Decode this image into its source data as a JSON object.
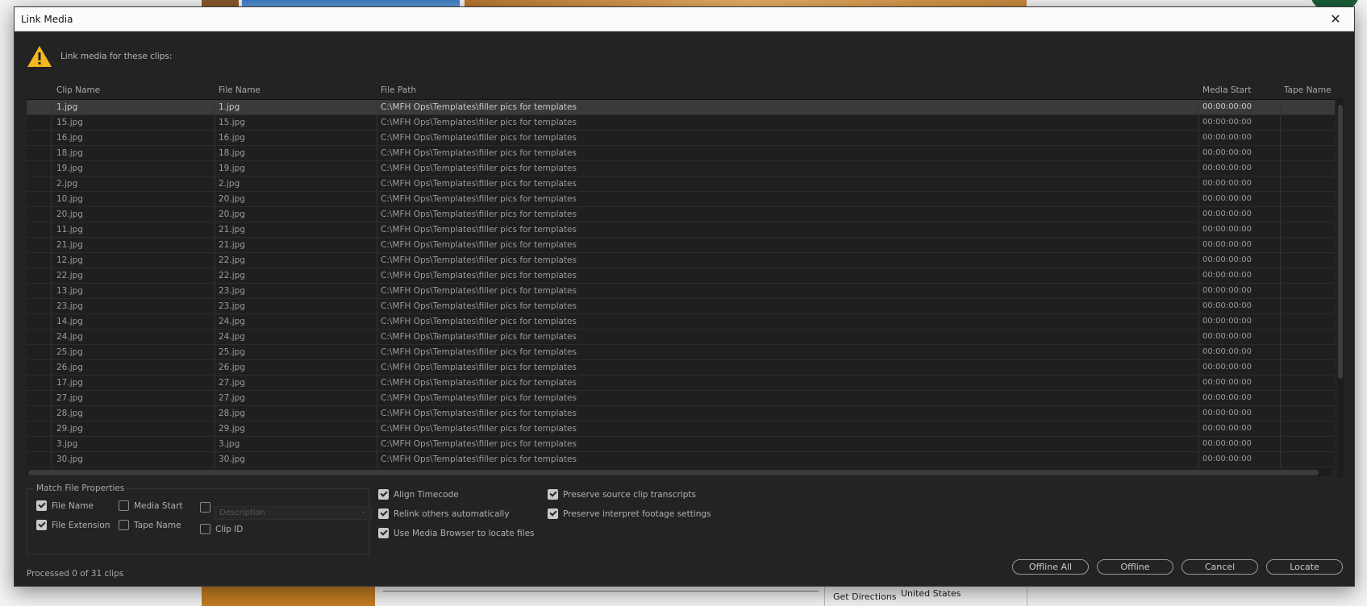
{
  "background": {
    "get_directions": "Get Directions",
    "country": "United States"
  },
  "dialog": {
    "title": "Link Media",
    "message": "Link media for these clips:"
  },
  "table": {
    "columns": [
      "Clip Name",
      "File Name",
      "File Path",
      "Media Start",
      "Tape Name"
    ],
    "rows": [
      {
        "clip": "1.jpg",
        "file": "1.jpg",
        "path": "C:\\MFH Ops\\Templates\\filler pics for templates",
        "start": "00:00:00:00"
      },
      {
        "clip": "15.jpg",
        "file": "15.jpg",
        "path": "C:\\MFH Ops\\Templates\\filler pics for templates",
        "start": "00:00:00:00"
      },
      {
        "clip": "16.jpg",
        "file": "16.jpg",
        "path": "C:\\MFH Ops\\Templates\\filler pics for templates",
        "start": "00:00:00:00"
      },
      {
        "clip": "18.jpg",
        "file": "18.jpg",
        "path": "C:\\MFH Ops\\Templates\\filler pics for templates",
        "start": "00:00:00:00"
      },
      {
        "clip": "19.jpg",
        "file": "19.jpg",
        "path": "C:\\MFH Ops\\Templates\\filler pics for templates",
        "start": "00:00:00:00"
      },
      {
        "clip": "2.jpg",
        "file": "2.jpg",
        "path": "C:\\MFH Ops\\Templates\\filler pics for templates",
        "start": "00:00:00:00"
      },
      {
        "clip": "10.jpg",
        "file": "20.jpg",
        "path": "C:\\MFH Ops\\Templates\\filler pics for templates",
        "start": "00:00:00:00"
      },
      {
        "clip": "20.jpg",
        "file": "20.jpg",
        "path": "C:\\MFH Ops\\Templates\\filler pics for templates",
        "start": "00:00:00:00"
      },
      {
        "clip": "11.jpg",
        "file": "21.jpg",
        "path": "C:\\MFH Ops\\Templates\\filler pics for templates",
        "start": "00:00:00:00"
      },
      {
        "clip": "21.jpg",
        "file": "21.jpg",
        "path": "C:\\MFH Ops\\Templates\\filler pics for templates",
        "start": "00:00:00:00"
      },
      {
        "clip": "12.jpg",
        "file": "22.jpg",
        "path": "C:\\MFH Ops\\Templates\\filler pics for templates",
        "start": "00:00:00:00"
      },
      {
        "clip": "22.jpg",
        "file": "22.jpg",
        "path": "C:\\MFH Ops\\Templates\\filler pics for templates",
        "start": "00:00:00:00"
      },
      {
        "clip": "13.jpg",
        "file": "23.jpg",
        "path": "C:\\MFH Ops\\Templates\\filler pics for templates",
        "start": "00:00:00:00"
      },
      {
        "clip": "23.jpg",
        "file": "23.jpg",
        "path": "C:\\MFH Ops\\Templates\\filler pics for templates",
        "start": "00:00:00:00"
      },
      {
        "clip": "14.jpg",
        "file": "24.jpg",
        "path": "C:\\MFH Ops\\Templates\\filler pics for templates",
        "start": "00:00:00:00"
      },
      {
        "clip": "24.jpg",
        "file": "24.jpg",
        "path": "C:\\MFH Ops\\Templates\\filler pics for templates",
        "start": "00:00:00:00"
      },
      {
        "clip": "25.jpg",
        "file": "25.jpg",
        "path": "C:\\MFH Ops\\Templates\\filler pics for templates",
        "start": "00:00:00:00"
      },
      {
        "clip": "26.jpg",
        "file": "26.jpg",
        "path": "C:\\MFH Ops\\Templates\\filler pics for templates",
        "start": "00:00:00:00"
      },
      {
        "clip": "17.jpg",
        "file": "27.jpg",
        "path": "C:\\MFH Ops\\Templates\\filler pics for templates",
        "start": "00:00:00:00"
      },
      {
        "clip": "27.jpg",
        "file": "27.jpg",
        "path": "C:\\MFH Ops\\Templates\\filler pics for templates",
        "start": "00:00:00:00"
      },
      {
        "clip": "28.jpg",
        "file": "28.jpg",
        "path": "C:\\MFH Ops\\Templates\\filler pics for templates",
        "start": "00:00:00:00"
      },
      {
        "clip": "29.jpg",
        "file": "29.jpg",
        "path": "C:\\MFH Ops\\Templates\\filler pics for templates",
        "start": "00:00:00:00"
      },
      {
        "clip": "3.jpg",
        "file": "3.jpg",
        "path": "C:\\MFH Ops\\Templates\\filler pics for templates",
        "start": "00:00:00:00"
      },
      {
        "clip": "30.jpg",
        "file": "30.jpg",
        "path": "C:\\MFH Ops\\Templates\\filler pics for templates",
        "start": "00:00:00:00"
      }
    ]
  },
  "match_file_properties": {
    "legend": "Match File Properties",
    "file_name": {
      "label": "File Name",
      "checked": true
    },
    "file_extension": {
      "label": "File Extension",
      "checked": true
    },
    "media_start": {
      "label": "Media Start",
      "checked": false
    },
    "tape_name": {
      "label": "Tape Name",
      "checked": false
    },
    "description": {
      "label": "Description",
      "checked": false
    },
    "clip_id": {
      "label": "Clip ID",
      "checked": false
    }
  },
  "options": {
    "align_timecode": {
      "label": "Align Timecode",
      "checked": true
    },
    "relink_others": {
      "label": "Relink others automatically",
      "checked": true
    },
    "use_media_browser": {
      "label": "Use Media Browser to locate files",
      "checked": true
    },
    "preserve_transcripts": {
      "label": "Preserve source clip transcripts",
      "checked": true
    },
    "preserve_interpret": {
      "label": "Preserve interpret footage settings",
      "checked": true
    }
  },
  "status": "Processed 0 of 31 clips",
  "buttons": {
    "offline_all": "Offline All",
    "offline": "Offline",
    "cancel": "Cancel",
    "locate": "Locate"
  },
  "colors": {
    "dialog_bg": "#232323",
    "warning": "#f2b81e"
  }
}
